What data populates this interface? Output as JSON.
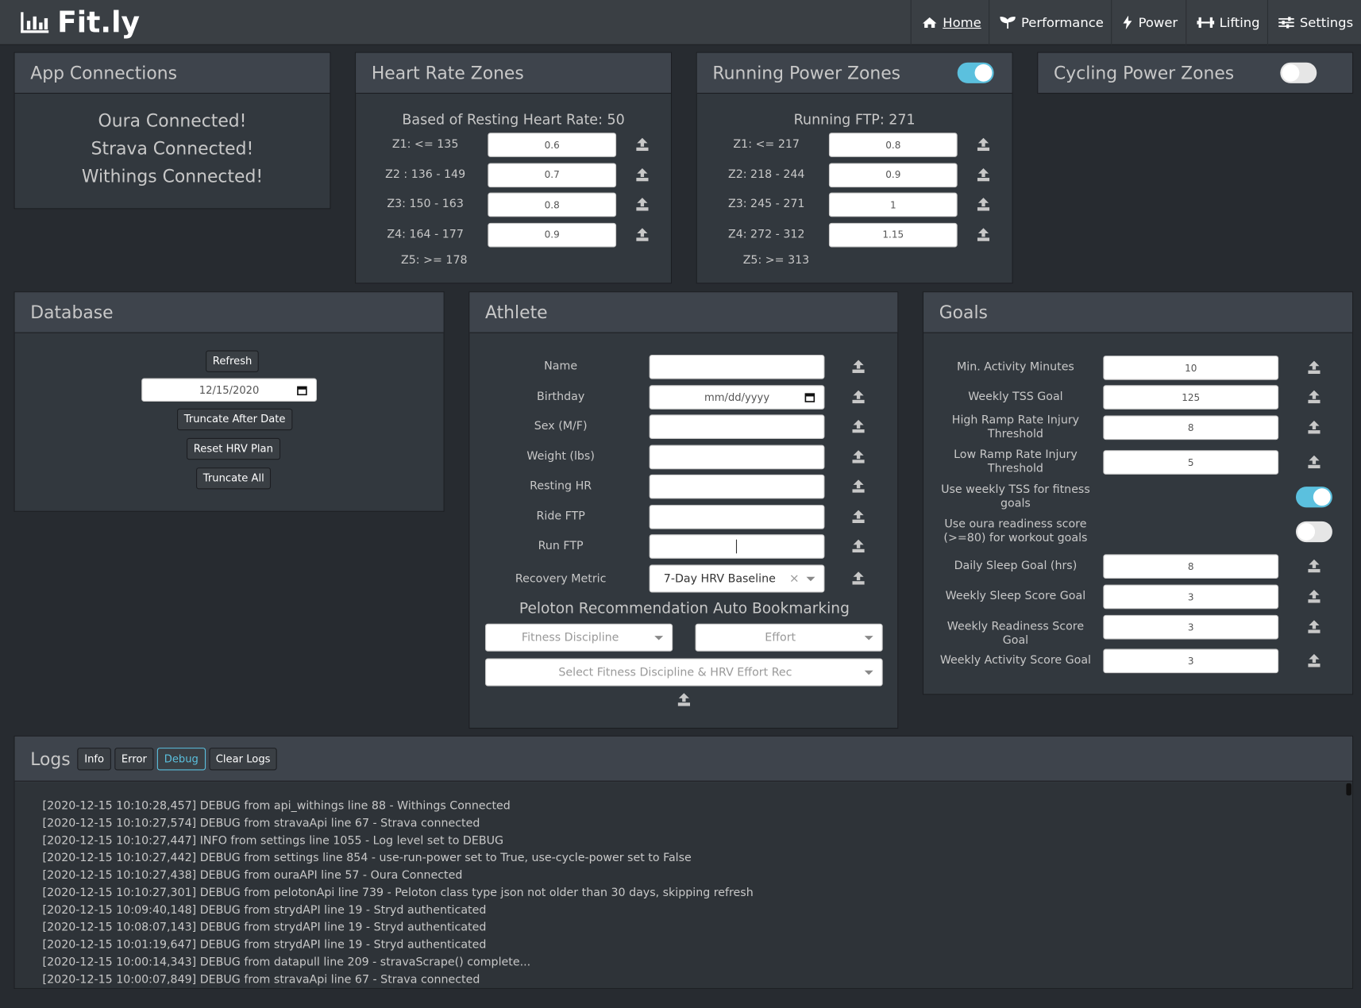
{
  "navbar": {
    "brand": "Fit.ly",
    "items": [
      {
        "label": "Home",
        "icon": "home-icon"
      },
      {
        "label": "Performance",
        "icon": "seedling-icon"
      },
      {
        "label": "Power",
        "icon": "bolt-icon"
      },
      {
        "label": "Lifting",
        "icon": "dumbbell-icon"
      },
      {
        "label": "Settings",
        "icon": "sliders-icon"
      }
    ]
  },
  "app_connections": {
    "title": "App Connections",
    "lines": [
      "Oura Connected!",
      "Strava Connected!",
      "Withings Connected!"
    ]
  },
  "hr_zones": {
    "title": "Heart Rate Zones",
    "subtitle": "Based of Resting Heart Rate: 50",
    "zones": [
      {
        "label": "Z1: <= 135",
        "value": "0.6"
      },
      {
        "label": "Z2 : 136 - 149",
        "value": "0.7"
      },
      {
        "label": "Z3: 150 - 163",
        "value": "0.8"
      },
      {
        "label": "Z4: 164 - 177",
        "value": "0.9"
      }
    ],
    "z5": "Z5: >= 178"
  },
  "run_power": {
    "title": "Running Power Zones",
    "toggle_on": true,
    "subtitle": "Running FTP: 271",
    "zones": [
      {
        "label": "Z1: <= 217",
        "value": "0.8"
      },
      {
        "label": "Z2: 218 - 244",
        "value": "0.9"
      },
      {
        "label": "Z3: 245 - 271",
        "value": "1"
      },
      {
        "label": "Z4: 272 - 312",
        "value": "1.15"
      }
    ],
    "z5": "Z5: >= 313"
  },
  "cycle_power": {
    "title": "Cycling Power Zones",
    "toggle_on": false
  },
  "database": {
    "title": "Database",
    "refresh": "Refresh",
    "date": "12/15/2020",
    "truncate_after": "Truncate After Date",
    "reset_hrv": "Reset HRV Plan",
    "truncate_all": "Truncate All"
  },
  "athlete": {
    "title": "Athlete",
    "fields": [
      {
        "label": "Name",
        "value": ""
      },
      {
        "label": "Birthday",
        "value": "mm/dd/yyyy"
      },
      {
        "label": "Sex (M/F)",
        "value": ""
      },
      {
        "label": "Weight (lbs)",
        "value": ""
      },
      {
        "label": "Resting HR",
        "value": ""
      },
      {
        "label": "Ride FTP",
        "value": ""
      },
      {
        "label": "Run FTP",
        "value": ""
      }
    ],
    "recovery_label": "Recovery Metric",
    "recovery_value": "7-Day HRV Baseline",
    "peloton_title": "Peloton Recommendation Auto Bookmarking",
    "fitness_discipline": "Fitness Discipline",
    "effort": "Effort",
    "select_rec": "Select Fitness Discipline & HRV Effort Rec"
  },
  "goals": {
    "title": "Goals",
    "items": [
      {
        "label": "Min. Activity Minutes",
        "type": "input",
        "value": "10"
      },
      {
        "label": "Weekly TSS Goal",
        "type": "input",
        "value": "125"
      },
      {
        "label": "High Ramp Rate Injury Threshold",
        "type": "input",
        "value": "8"
      },
      {
        "label": "Low Ramp Rate Injury Threshold",
        "type": "input",
        "value": "5"
      },
      {
        "label": "Use weekly TSS for fitness goals",
        "type": "toggle",
        "on": true
      },
      {
        "label": "Use oura readiness score (>=80) for workout goals",
        "type": "toggle",
        "on": false
      },
      {
        "label": "Daily Sleep Goal (hrs)",
        "type": "input",
        "value": "8"
      },
      {
        "label": "Weekly Sleep Score Goal",
        "type": "input",
        "value": "3"
      },
      {
        "label": "Weekly Readiness Score Goal",
        "type": "input",
        "value": "3"
      },
      {
        "label": "Weekly Activity Score Goal",
        "type": "input",
        "value": "3"
      }
    ]
  },
  "logs": {
    "title": "Logs",
    "buttons": {
      "info": "Info",
      "error": "Error",
      "debug": "Debug",
      "clear": "Clear Logs"
    },
    "active": "debug",
    "lines": [
      "[2020-12-15 10:10:28,457] DEBUG from api_withings line 88 - Withings Connected",
      "[2020-12-15 10:10:27,574] DEBUG from stravaApi line 67 - Strava connected",
      "[2020-12-15 10:10:27,447] INFO from settings line 1055 - Log level set to DEBUG",
      "[2020-12-15 10:10:27,442] DEBUG from settings line 854 - use-run-power set to True, use-cycle-power set to False",
      "[2020-12-15 10:10:27,438] DEBUG from ouraAPI line 57 - Oura Connected",
      "[2020-12-15 10:10:27,301] DEBUG from pelotonApi line 739 - Peloton class type json not older than 30 days, skipping refresh",
      "[2020-12-15 10:09:40,148] DEBUG from strydAPI line 19 - Stryd authenticated",
      "[2020-12-15 10:08:07,143] DEBUG from strydAPI line 19 - Stryd authenticated",
      "[2020-12-15 10:01:19,647] DEBUG from strydAPI line 19 - Stryd authenticated",
      "[2020-12-15 10:00:14,343] DEBUG from datapull line 209 - stravaScrape() complete...",
      "[2020-12-15 10:00:07,849] DEBUG from stravaApi line 67 - Strava connected"
    ]
  }
}
